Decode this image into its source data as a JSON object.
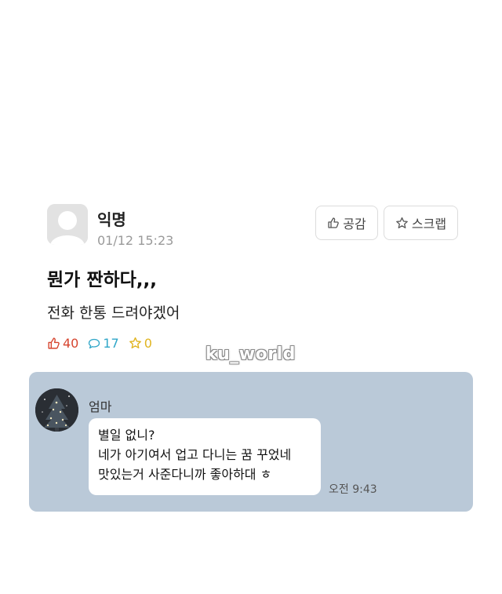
{
  "post": {
    "author": "익명",
    "timestamp": "01/12 15:23",
    "title": "뭔가 짠하다,,,",
    "body": "전화 한통 드려야겠어",
    "like_button_label": "공감",
    "scrap_button_label": "스크랩",
    "stats": {
      "likes": "40",
      "comments": "17",
      "scraps": "0"
    },
    "avatar_icon": "default-user-icon",
    "colors": {
      "like": "#d6452f",
      "comment": "#2fa6c8",
      "scrap": "#e0b420"
    }
  },
  "watermark": "ku_world",
  "chat": {
    "background": "#bac9d8",
    "sender": "엄마",
    "avatar_icon": "christmas-tree-photo",
    "message_lines": [
      "별일 없니?",
      "네가 아기여서 업고 다니는 꿈 꾸었네",
      "맛있는거 사준다니까 좋아하대 ㅎ"
    ],
    "time": "오전 9:43"
  }
}
